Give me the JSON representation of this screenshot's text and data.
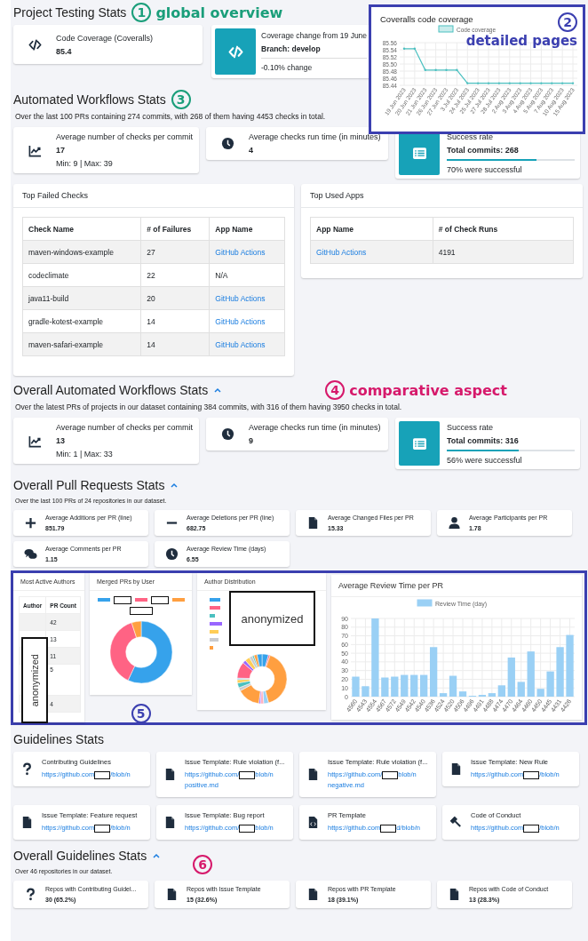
{
  "project_testing": {
    "title": "Project Testing Stats",
    "annotation": {
      "number": "1",
      "text": "global overview",
      "color": "#1a9e7a"
    },
    "coverage_card": {
      "label": "Code Coverage (Coveralls)",
      "value": "85.4"
    },
    "change_card": {
      "label": "Coverage change from 19 June",
      "branch": "Branch: develop",
      "change": "-0.10% change"
    }
  },
  "coverage_popup": {
    "title": "Coveralls code coverage",
    "annotation": {
      "number": "2",
      "text": "detailed pages",
      "color": "#3b3fb0"
    },
    "chart_data": {
      "type": "line",
      "grid": true,
      "ylim": [
        85.44,
        85.56
      ],
      "yticks": [
        {
          "value": 85.44,
          "label": "85.44"
        },
        {
          "value": 85.46,
          "label": "85.46"
        },
        {
          "value": 85.48,
          "label": "85.48"
        },
        {
          "value": 85.5,
          "label": "85.50"
        },
        {
          "value": 85.52,
          "label": "85.52"
        },
        {
          "value": 85.54,
          "label": "85.54"
        },
        {
          "value": 85.56,
          "label": "85.56"
        }
      ],
      "categories": [
        "19 Jun 2023",
        "20 Jun 2023",
        "21 Jun 2023",
        "26 Jun 2023",
        "27 Jun 2023",
        "3 Jul 2023",
        "24 Jul 2023",
        "25 Jul 2023",
        "27 Jul 2023",
        "28 Jul 2023",
        "2 Aug 2023",
        "3 Aug 2023",
        "4 Aug 2023",
        "5 Aug 2023",
        "7 Aug 2023",
        "10 Aug 2023",
        "15 Aug 2023"
      ],
      "series": [
        {
          "name": "Code coverage",
          "color": "#4bc0c0",
          "values": [
            85.543,
            85.543,
            85.483,
            85.483,
            85.483,
            85.483,
            85.446,
            85.446,
            85.446,
            85.446,
            85.446,
            85.446,
            85.446,
            85.446,
            85.446,
            85.446,
            85.446
          ]
        }
      ]
    }
  },
  "automated_workflows": {
    "title": "Automated Workflows Stats",
    "annotation": {
      "number": "3",
      "color": "#1a9e7a"
    },
    "description": "Over the last 100 PRs containing 274 commits, with 268 of them having 4453 checks in total.",
    "cards": [
      {
        "kind": "stat",
        "label": "Average number of checks per commit",
        "value": "17",
        "sub": "Min: 9 | Max: 39"
      },
      {
        "kind": "stat",
        "label": "Average checks run time (in minutes)",
        "value": "4"
      },
      {
        "kind": "success",
        "label": "Success rate",
        "value": "Total commits: 268",
        "level": 0.7,
        "sub": "70% were successful"
      }
    ]
  },
  "top_failed_checks": {
    "title": "Top Failed Checks",
    "columns": [
      "Check Name",
      "# of Failures",
      "App Name"
    ],
    "rows": [
      {
        "check": "maven-windows-example",
        "failures": "27",
        "app": "GitHub Actions",
        "app_link": true
      },
      {
        "check": "codeclimate",
        "failures": "22",
        "app": "N/A",
        "app_link": false
      },
      {
        "check": "java11-build",
        "failures": "20",
        "app": "GitHub Actions",
        "app_link": true
      },
      {
        "check": "gradle-kotest-example",
        "failures": "14",
        "app": "GitHub Actions",
        "app_link": true
      },
      {
        "check": "maven-safari-example",
        "failures": "14",
        "app": "GitHub Actions",
        "app_link": true
      }
    ]
  },
  "top_used_apps": {
    "title": "Top Used Apps",
    "columns": [
      "App Name",
      "# of Check Runs"
    ],
    "rows": [
      {
        "app": "GitHub Actions",
        "app_link": true,
        "runs": "4191"
      }
    ]
  },
  "overall_workflows": {
    "title": "Overall Automated Workflows Stats",
    "expanded": true,
    "annotation": {
      "number": "4",
      "text": "comparative aspect",
      "color": "#d6196b"
    },
    "description": "Over the latest PRs of projects in our dataset containing 384 commits, with 316 of them having 3950 checks in total.",
    "cards": [
      {
        "kind": "stat",
        "label": "Average number of checks per commit",
        "value": "13",
        "sub": "Min: 1 | Max: 33"
      },
      {
        "kind": "stat",
        "label": "Average checks run time (in minutes)",
        "value": "9"
      },
      {
        "kind": "success",
        "label": "Success rate",
        "value": "Total commits: 316",
        "level": 0.56,
        "sub": "56% were successful"
      }
    ]
  },
  "overall_pull_requests": {
    "title": "Overall Pull Requests Stats",
    "expanded": true,
    "description": "Over the last 100 PRs of 24 repositories in our dataset.",
    "cards": [
      {
        "label": "Average Additions per PR (line)",
        "value": "851.79"
      },
      {
        "label": "Average Deletions per PR (line)",
        "value": "682.75"
      },
      {
        "label": "Average Changed Files per PR",
        "value": "15.33"
      },
      {
        "label": "Average Participants per PR",
        "value": "1.78"
      },
      {
        "label": "Average Comments per PR",
        "value": "1.15"
      },
      {
        "label": "Average Review Time (days)",
        "value": "6.55"
      }
    ]
  },
  "charts_panel": {
    "annotation": {
      "number": "5",
      "color": "#3b3fb0"
    },
    "most_active_authors": {
      "title": "Most Active Authors",
      "columns": [
        "Author",
        "PR Count"
      ],
      "counts": [
        "42",
        "13",
        "11",
        "5",
        "4"
      ],
      "redaction": "anonymized"
    },
    "merged_prs": {
      "title": "Merged PRs by User"
    },
    "author_distribution": {
      "title": "Author Distribution",
      "redaction": "anonymized"
    },
    "review_time": {
      "title": "Average Review Time per PR",
      "chart_data": {
        "type": "bar",
        "grid": true,
        "ylim": [
          0,
          90
        ],
        "yticks": [
          0,
          10,
          20,
          30,
          40,
          50,
          60,
          70,
          80,
          90
        ],
        "categories": [
          "4560",
          "4543",
          "4554",
          "4567",
          "4572",
          "4549",
          "4542",
          "4540",
          "4536",
          "4524",
          "4520",
          "4506",
          "4496",
          "4491",
          "4488",
          "4474",
          "4470",
          "4464",
          "4460",
          "4450",
          "4445",
          "4431",
          "4426"
        ],
        "series": [
          {
            "name": "Review Time (day)",
            "color": "#9ad0f5",
            "values": [
              23,
              12,
              90,
              22,
              23,
              25,
              25,
              25,
              57,
              4,
              24,
              6,
              1,
              2,
              4,
              13,
              45,
              17,
              52,
              9,
              29,
              57,
              71
            ]
          }
        ]
      }
    }
  },
  "guidelines": {
    "title": "Guidelines Stats",
    "cards": [
      {
        "label": "Contributing Guidelines",
        "link_start": "https://github.com",
        "link_end": "/blob/n"
      },
      {
        "label": "Issue Template: Rule violation (f...",
        "link_start": "https://github.com/",
        "link_end": "blob/n",
        "link_more": "positive.md"
      },
      {
        "label": "Issue Template: Rule violation (f...",
        "link_start": "https://github.com/",
        "link_end": "blob/n",
        "link_more": "negative.md"
      },
      {
        "label": "Issue Template: New Rule",
        "link_start": "https://github.com",
        "link_end": "/blob/n"
      },
      {
        "label": "Issue Template: Feature request",
        "link_start": "https://github.com",
        "link_end": "/blob/n"
      },
      {
        "label": "Issue Template: Bug report",
        "link_start": "https://github.com/",
        "link_end": "blob/n"
      },
      {
        "label": "PR Template",
        "link_start": "https://github.com",
        "link_end": "d/blob/n"
      },
      {
        "label": "Code of Conduct",
        "link_start": "https://github.com",
        "link_end": "/blob/n"
      }
    ]
  },
  "overall_guidelines": {
    "title": "Overall Guidelines Stats",
    "expanded": true,
    "annotation": {
      "number": "6",
      "color": "#d6196b"
    },
    "description": "Over 46 repositories in our dataset.",
    "cards": [
      {
        "label": "Repos with Contributing Guidel...",
        "value": "30 (65.2%)"
      },
      {
        "label": "Repos with Issue Template",
        "value": "15 (32.6%)"
      },
      {
        "label": "Repos with PR Template",
        "value": "18 (39.1%)"
      },
      {
        "label": "Repos with Code of Conduct",
        "value": "13 (28.3%)"
      }
    ]
  }
}
